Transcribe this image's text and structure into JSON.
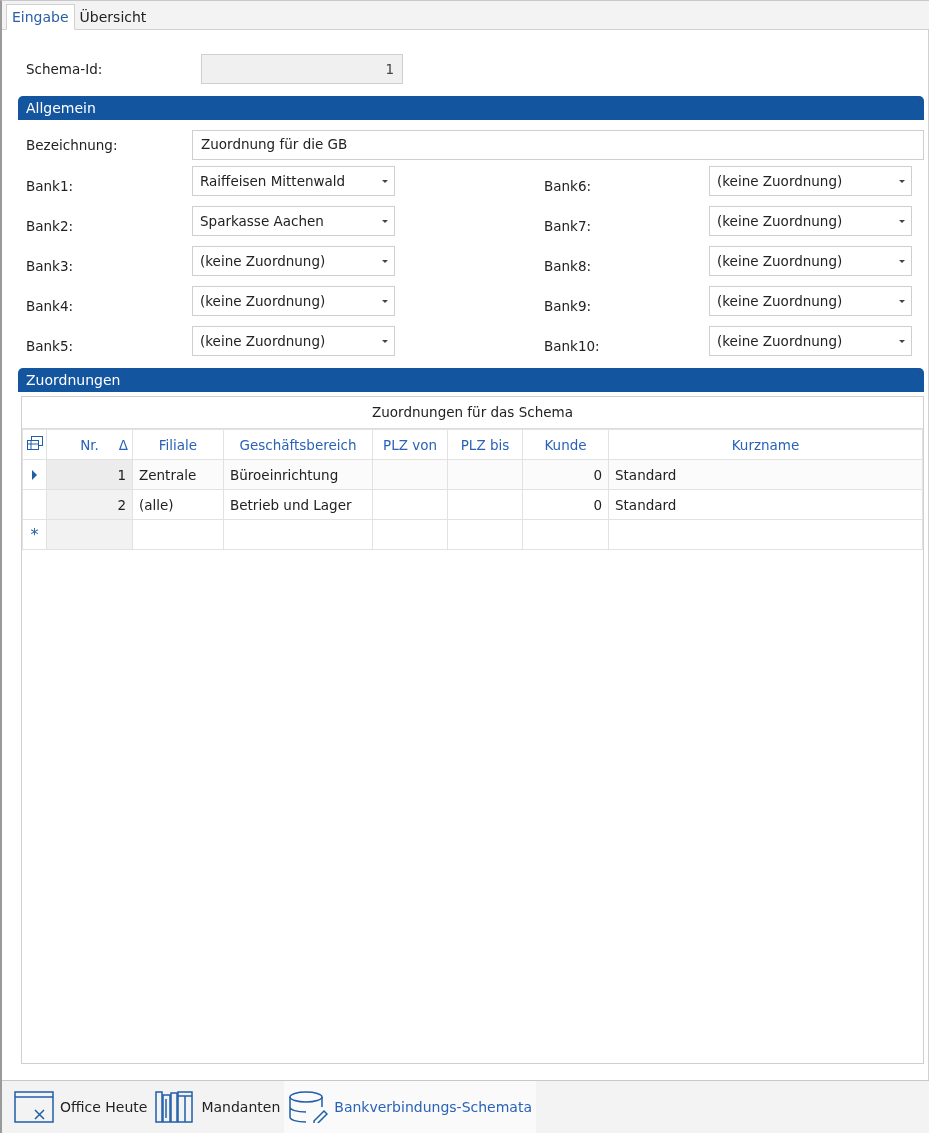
{
  "tabs": [
    {
      "label": "Eingabe",
      "selected": true
    },
    {
      "label": "Übersicht",
      "selected": false
    }
  ],
  "schema_id": {
    "label": "Schema-Id:",
    "value": "1",
    "disabled": true
  },
  "allgemein": {
    "title": "Allgemein",
    "bezeichnung": {
      "label": "Bezeichnung:",
      "value": "Zuordnung für die GB"
    },
    "banks": [
      {
        "label": "Bank1:",
        "value": "Raiffeisen Mittenwald"
      },
      {
        "label": "Bank2:",
        "value": "Sparkasse Aachen"
      },
      {
        "label": "Bank3:",
        "value": "(keine Zuordnung)"
      },
      {
        "label": "Bank4:",
        "value": "(keine Zuordnung)"
      },
      {
        "label": "Bank5:",
        "value": "(keine Zuordnung)"
      },
      {
        "label": "Bank6:",
        "value": "(keine Zuordnung)"
      },
      {
        "label": "Bank7:",
        "value": "(keine Zuordnung)"
      },
      {
        "label": "Bank8:",
        "value": "(keine Zuordnung)"
      },
      {
        "label": "Bank9:",
        "value": "(keine Zuordnung)"
      },
      {
        "label": "Bank10:",
        "value": "(keine Zuordnung)"
      }
    ]
  },
  "zuordnungen": {
    "title": "Zuordnungen",
    "table": {
      "caption": "Zuordnungen für das Schema",
      "sort_indicator": "Δ",
      "columns": [
        "Nr.",
        "Filiale",
        "Geschäftsbereich",
        "PLZ von",
        "PLZ bis",
        "Kunde",
        "Kurzname"
      ],
      "rows": [
        {
          "cells": [
            "1",
            "Zentrale",
            "Büroeinrichtung",
            "",
            "",
            "0",
            "Standard"
          ],
          "selected": true
        },
        {
          "cells": [
            "2",
            "(alle)",
            "Betrieb und Lager",
            "",
            "",
            "0",
            "Standard"
          ],
          "selected": false
        }
      ],
      "new_row_marker": "*"
    }
  },
  "nav": [
    {
      "label": "Office Heute",
      "selected": false
    },
    {
      "label": "Mandanten",
      "selected": false
    },
    {
      "label": "Bankverbindungs-Schemata",
      "selected": true
    }
  ]
}
